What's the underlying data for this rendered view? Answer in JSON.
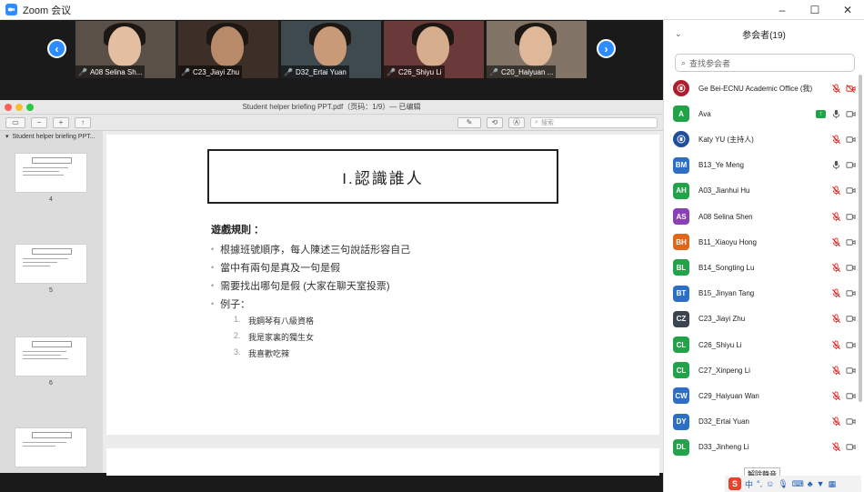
{
  "window": {
    "title": "Zoom 会议",
    "minimize": "–",
    "maximize": "☐",
    "close": "✕"
  },
  "strip": {
    "tiles": [
      {
        "name": "A08 Selina Sh...",
        "bg": "#5a5048",
        "face": "#e4bea1"
      },
      {
        "name": "C23_Jiayi Zhu",
        "bg": "#3c2f27",
        "face": "#b88a69"
      },
      {
        "name": "D32_Ertai Yuan",
        "bg": "#3f4a4f",
        "face": "#c89a78"
      },
      {
        "name": "C26_Shiyu Li",
        "bg": "#6a3a3a",
        "face": "#d6ad8d"
      },
      {
        "name": "C20_Haiyuan ...",
        "bg": "#827466",
        "face": "#dfb899"
      }
    ]
  },
  "pdf": {
    "doc_title": "Student helper briefing PPT.pdf（页码：1/9）— 已编辑",
    "sidebar_title": "Student helper briefing PPT...",
    "search_placeholder": "搜索",
    "thumb_numbers": [
      "4",
      "5",
      "6"
    ]
  },
  "slide": {
    "title": "I.認識誰人",
    "rules_heading": "遊戲規則 ：",
    "bullets": [
      "根據班號順序，每人陳述三句說話形容自己",
      "當中有兩句是真及一句是假",
      "需要找出哪句是假 (大家在聊天室投票)",
      "例子："
    ],
    "sub_numbers": [
      "1.",
      "2.",
      "3."
    ],
    "sub_items": [
      "我鋼琴有八級資格",
      "我是家裏的獨生女",
      "我喜歡吃辣"
    ]
  },
  "panel": {
    "title": "参会者(19)",
    "collapse": "⌄",
    "search_placeholder": "查找参会者",
    "participants": [
      {
        "name": "Ge Bei-ECNU Academic Office (我)",
        "initials": "",
        "color": "#b01c2e",
        "mic": "muted",
        "video": "off",
        "logo": true
      },
      {
        "name": "Ava",
        "initials": "A",
        "color": "#22a34a",
        "mic": "on",
        "video": "on",
        "share": true
      },
      {
        "name": "Katy YU (主持人)",
        "initials": "",
        "color": "#1f4e9c",
        "mic": "muted",
        "video": "on",
        "logo": true
      },
      {
        "name": "B13_Ye Meng",
        "initials": "BM",
        "color": "#2d6fc4",
        "mic": "on",
        "video": "on"
      },
      {
        "name": "A03_Jianhui Hu",
        "initials": "AH",
        "color": "#22a34a",
        "mic": "muted",
        "video": "on"
      },
      {
        "name": "A08 Selina Shen",
        "initials": "AS",
        "color": "#8a3fb5",
        "mic": "muted",
        "video": "on"
      },
      {
        "name": "B11_Xiaoyu Hong",
        "initials": "BH",
        "color": "#e0661c",
        "mic": "muted",
        "video": "on"
      },
      {
        "name": "B14_Songting Lu",
        "initials": "BL",
        "color": "#22a34a",
        "mic": "muted",
        "video": "on"
      },
      {
        "name": "B15_Jinyan Tang",
        "initials": "BT",
        "color": "#2d6fc4",
        "mic": "muted",
        "video": "on"
      },
      {
        "name": "C23_Jiayi Zhu",
        "initials": "CZ",
        "color": "#3b4451",
        "mic": "muted",
        "video": "on"
      },
      {
        "name": "C26_Shiyu Li",
        "initials": "CL",
        "color": "#22a34a",
        "mic": "muted",
        "video": "on"
      },
      {
        "name": "C27_Xinpeng Li",
        "initials": "CL",
        "color": "#22a34a",
        "mic": "muted",
        "video": "on"
      },
      {
        "name": "C29_Haiyuan Wan",
        "initials": "CW",
        "color": "#2d6fc4",
        "mic": "muted",
        "video": "on"
      },
      {
        "name": "D32_Ertai Yuan",
        "initials": "DY",
        "color": "#2d6fc4",
        "mic": "muted",
        "video": "on"
      },
      {
        "name": "D33_Jinheng Li",
        "initials": "DL",
        "color": "#22a34a",
        "mic": "muted",
        "video": "on"
      }
    ]
  },
  "tooltip": "解除静音",
  "ime": {
    "logo": "S",
    "lang": "中"
  }
}
